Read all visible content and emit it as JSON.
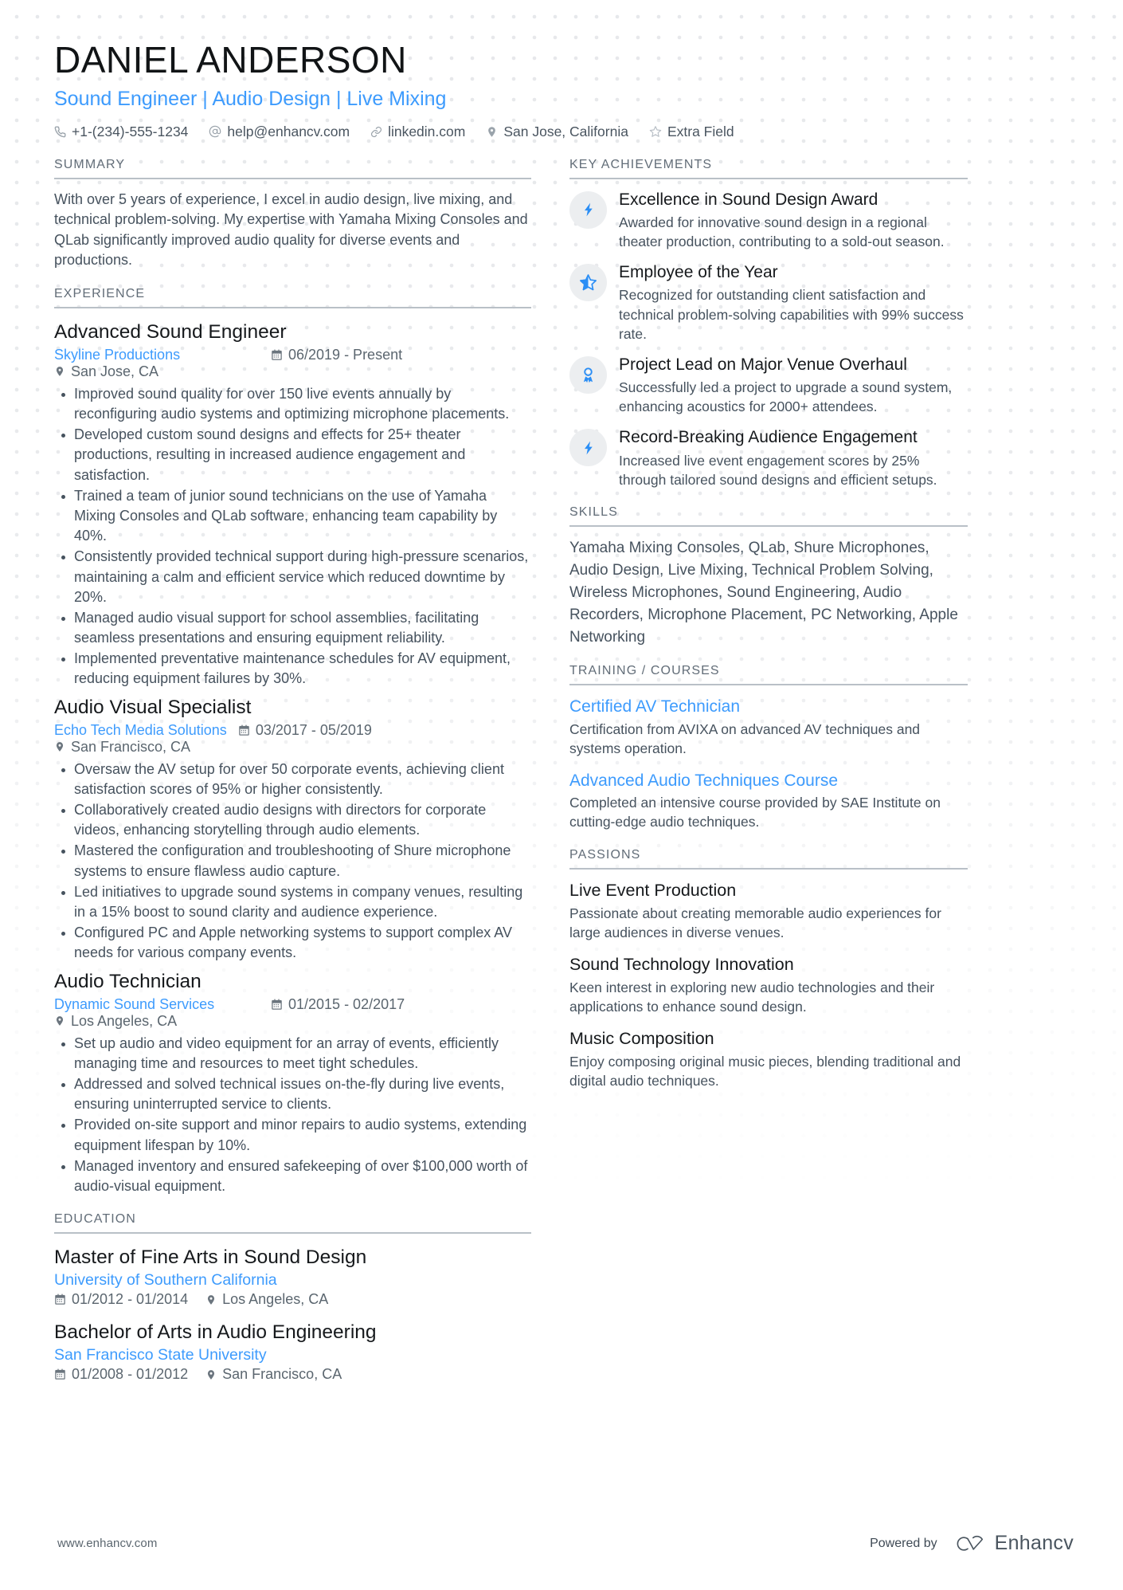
{
  "header": {
    "name": "DANIEL ANDERSON",
    "job_title": "Sound Engineer | Audio Design | Live Mixing",
    "accent_color": "#3d9bfd",
    "contacts": [
      {
        "icon": "phone-icon",
        "text": "+1-(234)-555-1234"
      },
      {
        "icon": "email-icon",
        "text": "help@enhancv.com"
      },
      {
        "icon": "link-icon",
        "text": "linkedin.com"
      },
      {
        "icon": "location-pin-icon",
        "text": "San Jose, California"
      },
      {
        "icon": "star-outline-icon",
        "text": "Extra Field"
      }
    ]
  },
  "summary": {
    "heading": "SUMMARY",
    "text": "With over 5 years of experience, I excel in audio design, live mixing, and technical problem-solving. My expertise with Yamaha Mixing Consoles and QLab significantly improved audio quality for diverse events and productions."
  },
  "experience": {
    "heading": "EXPERIENCE",
    "jobs": [
      {
        "role": "Advanced Sound Engineer",
        "company": "Skyline Productions",
        "dates": "06/2019 - Present",
        "location": "San Jose, CA",
        "bullets": [
          "Improved sound quality for over 150 live events annually by reconfiguring audio systems and optimizing microphone placements.",
          "Developed custom sound designs and effects for 25+ theater productions, resulting in increased audience engagement and satisfaction.",
          "Trained a team of junior sound technicians on the use of Yamaha Mixing Consoles and QLab software, enhancing team capability by 40%.",
          "Consistently provided technical support during high-pressure scenarios, maintaining a calm and efficient service which reduced downtime by 20%.",
          "Managed audio visual support for school assemblies, facilitating seamless presentations and ensuring equipment reliability.",
          "Implemented preventative maintenance schedules for AV equipment, reducing equipment failures by 30%."
        ]
      },
      {
        "role": "Audio Visual Specialist",
        "company": "Echo Tech Media Solutions",
        "dates": "03/2017 - 05/2019",
        "location": "San Francisco, CA",
        "bullets": [
          "Oversaw the AV setup for over 50 corporate events, achieving client satisfaction scores of 95% or higher consistently.",
          "Collaboratively created audio designs with directors for corporate videos, enhancing storytelling through audio elements.",
          "Mastered the configuration and troubleshooting of Shure microphone systems to ensure flawless audio capture.",
          "Led initiatives to upgrade sound systems in company venues, resulting in a 15% boost to sound clarity and audience experience.",
          "Configured PC and Apple networking systems to support complex AV needs for various company events."
        ]
      },
      {
        "role": "Audio Technician",
        "company": "Dynamic Sound Services",
        "dates": "01/2015 - 02/2017",
        "location": "Los Angeles, CA",
        "bullets": [
          "Set up audio and video equipment for an array of events, efficiently managing time and resources to meet tight schedules.",
          "Addressed and solved technical issues on-the-fly during live events, ensuring uninterrupted service to clients.",
          "Provided on-site support and minor repairs to audio systems, extending equipment lifespan by 10%.",
          "Managed inventory and ensured safekeeping of over $100,000 worth of audio-visual equipment."
        ]
      }
    ]
  },
  "education": {
    "heading": "EDUCATION",
    "items": [
      {
        "degree": "Master of Fine Arts in Sound Design",
        "school": "University of Southern California",
        "dates": "01/2012 - 01/2014",
        "location": "Los Angeles, CA"
      },
      {
        "degree": "Bachelor of Arts in Audio Engineering",
        "school": "San Francisco State University",
        "dates": "01/2008 - 01/2012",
        "location": "San Francisco, CA"
      }
    ]
  },
  "key_achievements": {
    "heading": "KEY ACHIEVEMENTS",
    "items": [
      {
        "icon": "lightning-bolt-icon",
        "title": "Excellence in Sound Design Award",
        "desc": "Awarded for innovative sound design in a regional theater production, contributing to a sold-out season."
      },
      {
        "icon": "star-half-icon",
        "title": "Employee of the Year",
        "desc": "Recognized for outstanding client satisfaction and technical problem-solving capabilities with 99% success rate."
      },
      {
        "icon": "award-ribbon-icon",
        "title": "Project Lead on Major Venue Overhaul",
        "desc": "Successfully led a project to upgrade a sound system, enhancing acoustics for 2000+ attendees."
      },
      {
        "icon": "lightning-bolt-icon",
        "title": "Record-Breaking Audience Engagement",
        "desc": "Increased live event engagement scores by 25% through tailored sound designs and efficient setups."
      }
    ]
  },
  "skills": {
    "heading": "SKILLS",
    "text": "Yamaha Mixing Consoles, QLab, Shure Microphones, Audio Design, Live Mixing, Technical Problem Solving, Wireless Microphones, Sound Engineering, Audio Recorders, Microphone Placement, PC Networking, Apple Networking"
  },
  "training": {
    "heading": "TRAINING / COURSES",
    "items": [
      {
        "title": "Certified AV Technician",
        "desc": "Certification from AVIXA on advanced AV techniques and systems operation."
      },
      {
        "title": "Advanced Audio Techniques Course",
        "desc": "Completed an intensive course provided by SAE Institute on cutting-edge audio techniques."
      }
    ]
  },
  "passions": {
    "heading": "PASSIONS",
    "items": [
      {
        "title": "Live Event Production",
        "desc": "Passionate about creating memorable audio experiences for large audiences in diverse venues."
      },
      {
        "title": "Sound Technology Innovation",
        "desc": "Keen interest in exploring new audio technologies and their applications to enhance sound design."
      },
      {
        "title": "Music Composition",
        "desc": "Enjoy composing original music pieces, blending traditional and digital audio techniques."
      }
    ]
  },
  "footer": {
    "url": "www.enhancv.com",
    "powered_by": "Powered by",
    "brand": "Enhancv"
  }
}
